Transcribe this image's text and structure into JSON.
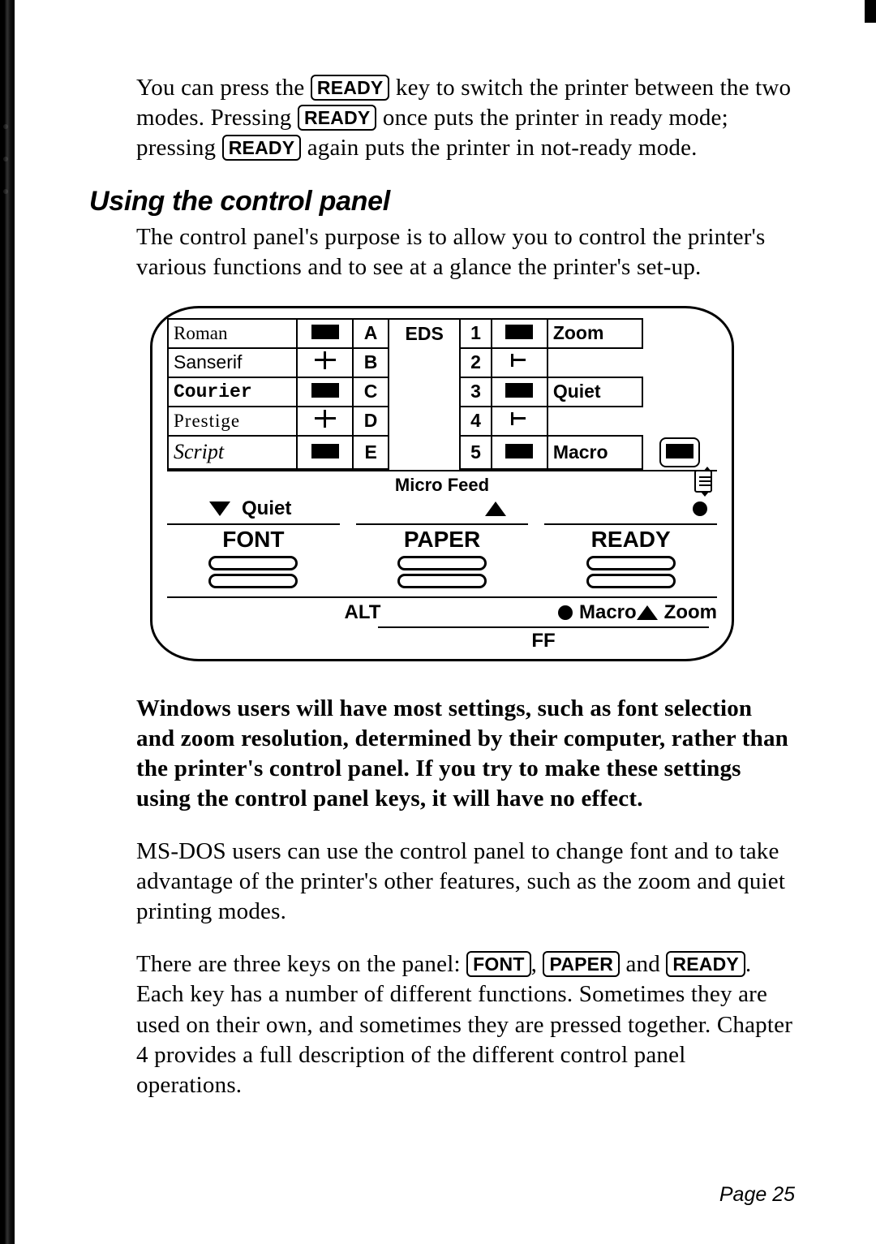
{
  "para1_frag1": "You can press the ",
  "para1_frag2": " key to switch the printer between the two modes. Pressing ",
  "para1_frag3": " once puts the printer in ready mode; pressing ",
  "para1_frag4": " again puts the printer in not-ready mode.",
  "key_ready": "READY",
  "key_font": "FONT",
  "key_paper": "PAPER",
  "heading": "Using the control panel",
  "para2": "The control panel's purpose is to allow you to control the printer's various functions and to see at a glance the printer's set-up.",
  "panel": {
    "fonts": [
      "Roman",
      "Sanserif",
      "Courier",
      "Prestige",
      "Script"
    ],
    "col_letters": [
      "A",
      "B",
      "C",
      "D",
      "E"
    ],
    "eds_label": "EDS",
    "nums": [
      "1",
      "2",
      "3",
      "4",
      "5"
    ],
    "right_labels": {
      "zoom": "Zoom",
      "quiet": "Quiet",
      "macro": "Macro"
    },
    "micro_feed": "Micro Feed",
    "quiet_row": "Quiet",
    "buttons": {
      "font": "FONT",
      "paper": "PAPER",
      "ready": "READY"
    },
    "alt": "ALT",
    "macro_row": "Macro",
    "zoom_row": "Zoom",
    "ff": "FF"
  },
  "bold_para": "Windows users will have most settings, such as font selection and zoom resolution, determined by their computer, rather than the printer's control panel. If you try to make these settings using the control panel keys, it will have no effect.",
  "para3": "MS-DOS users can use the control panel to change font and to take advantage of the printer's other features, such as the zoom and quiet printing modes.",
  "para4_frag1": "There are three keys on the panel: ",
  "para4_frag2": ", ",
  "para4_frag3": " and ",
  "para4_frag4": ". Each key has a number of different functions. Sometimes they are used on their own, and sometimes they are pressed together. Chapter 4 provides a full description of the different control panel operations.",
  "page_number": "Page 25"
}
